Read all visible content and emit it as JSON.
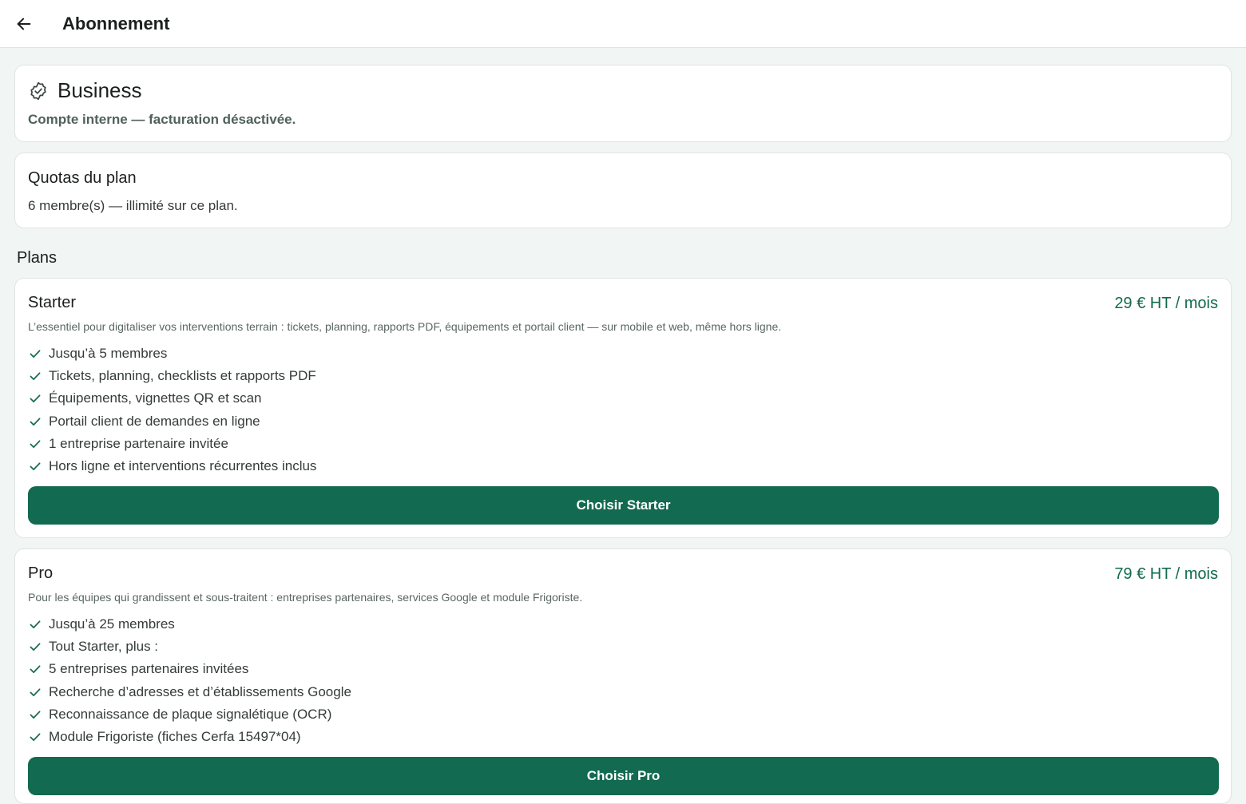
{
  "header": {
    "title": "Abonnement",
    "back_icon": "arrow-left-icon"
  },
  "current_plan": {
    "icon": "verified-badge-icon",
    "name": "Business",
    "note": "Compte interne — facturation désactivée."
  },
  "quotas": {
    "title": "Quotas du plan",
    "text": "6 membre(s) — illimité sur ce plan."
  },
  "plans_heading": "Plans",
  "plans": [
    {
      "name": "Starter",
      "price": "29 € HT / mois",
      "description": "L’essentiel pour digitaliser vos interventions terrain : tickets, planning, rapports PDF, équipements et portail client — sur mobile et web, même hors ligne.",
      "features": [
        "Jusqu’à 5 membres",
        "Tickets, planning, checklists et rapports PDF",
        "Équipements, vignettes QR et scan",
        "Portail client de demandes en ligne",
        "1 entreprise partenaire invitée",
        "Hors ligne et interventions récurrentes inclus"
      ],
      "button_label": "Choisir Starter"
    },
    {
      "name": "Pro",
      "price": "79 € HT / mois",
      "description": "Pour les équipes qui grandissent et sous-traitent : entreprises partenaires, services Google et module Frigoriste.",
      "features": [
        "Jusqu’à 25 membres",
        "Tout Starter, plus :",
        "5 entreprises partenaires invitées",
        "Recherche d’adresses et d’établissements Google",
        "Reconnaissance de plaque signalétique (OCR)",
        "Module Frigoriste (fiches Cerfa 15497*04)"
      ],
      "button_label": "Choisir Pro"
    }
  ],
  "colors": {
    "accent": "#126a50",
    "price": "#136a50",
    "background": "#f1f5f3"
  }
}
